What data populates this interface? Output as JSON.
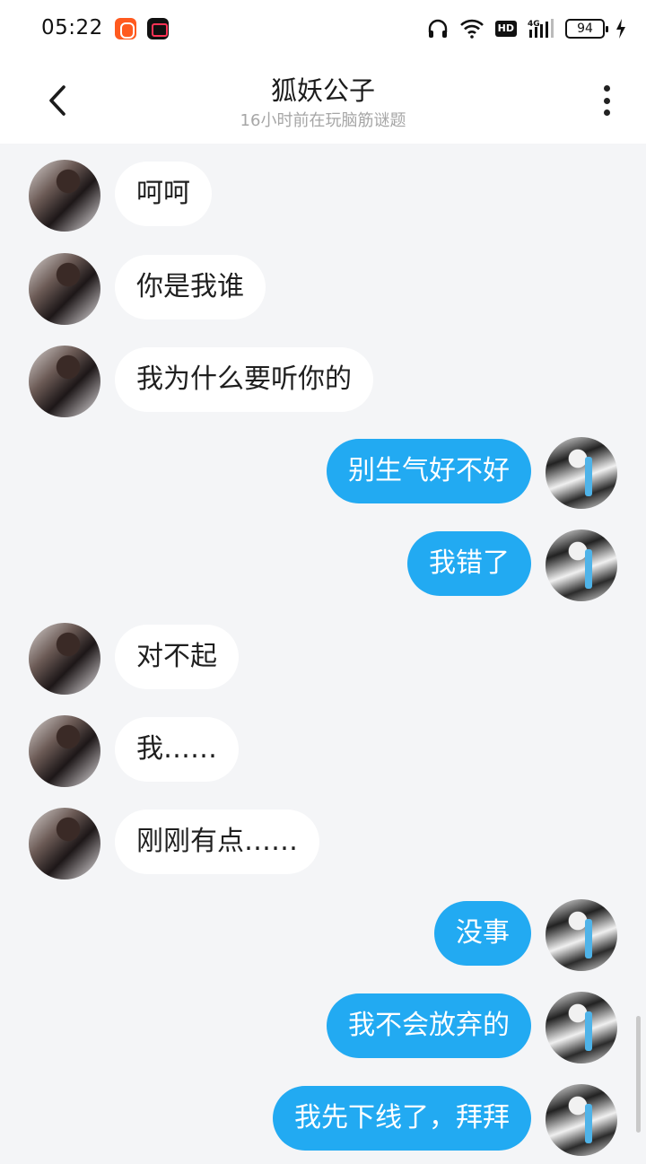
{
  "status_bar": {
    "time": "05:22",
    "icons": [
      "kuaishou-app-icon",
      "screen-record-icon",
      "headphones-icon",
      "wifi-icon",
      "hd-icon",
      "4g-signal-icon",
      "battery-icon",
      "charging-icon"
    ],
    "hd_label": "HD",
    "network_label": "4G",
    "battery": "94"
  },
  "header": {
    "title": "狐妖公子",
    "subtitle": "16小时前在玩脑筋谜题",
    "back_icon": "chevron-left-icon",
    "more_icon": "more-vertical-icon"
  },
  "colors": {
    "background": "#f4f5f7",
    "self_bubble": "#22aaf2",
    "other_bubble": "#ffffff"
  },
  "messages": [
    {
      "side": "left",
      "text": "呵呵"
    },
    {
      "side": "left",
      "text": "你是我谁"
    },
    {
      "side": "left",
      "text": "我为什么要听你的"
    },
    {
      "side": "right",
      "text": "别生气好不好"
    },
    {
      "side": "right",
      "text": "我错了"
    },
    {
      "side": "left",
      "text": "对不起"
    },
    {
      "side": "left",
      "text": "我……"
    },
    {
      "side": "left",
      "text": "刚刚有点……"
    },
    {
      "side": "right",
      "text": "没事"
    },
    {
      "side": "right",
      "text": "我不会放弃的"
    },
    {
      "side": "right",
      "text": "我先下线了，拜拜"
    }
  ]
}
